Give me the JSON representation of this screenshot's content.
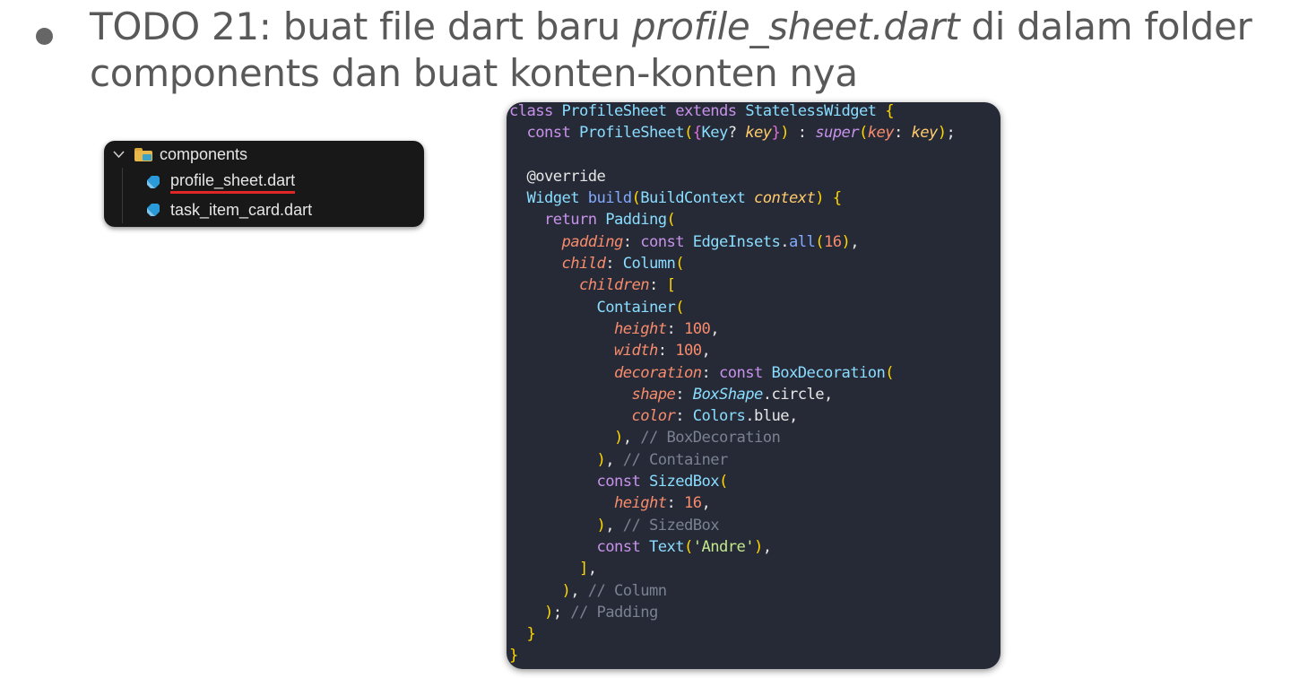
{
  "heading": {
    "part1": "TODO 21: buat file dart baru ",
    "file_italic": "profile_sheet.dart",
    "part2": " di dalam folder components dan buat konten-konten nya"
  },
  "explorer": {
    "folder": "components",
    "files": [
      "profile_sheet.dart",
      "task_item_card.dart"
    ]
  },
  "code_lines": {
    "l1": "class ProfileSheet extends StatelessWidget {",
    "l2": "  const ProfileSheet({Key? key}) : super(key: key);",
    "l3": "",
    "l4": "  @override",
    "l5": "  Widget build(BuildContext context) {",
    "l6": "    return Padding(",
    "l7": "      padding: const EdgeInsets.all(16),",
    "l8": "      child: Column(",
    "l9": "        children: [",
    "l10": "          Container(",
    "l11": "            height: 100,",
    "l12": "            width: 100,",
    "l13": "            decoration: const BoxDecoration(",
    "l14": "              shape: BoxShape.circle,",
    "l15": "              color: Colors.blue,",
    "l16": "            ), // BoxDecoration",
    "l17": "          ), // Container",
    "l18": "          const SizedBox(",
    "l19": "            height: 16,",
    "l20": "          ), // SizedBox",
    "l21": "          const Text('Andre'),",
    "l22": "        ],",
    "l23": "      ), // Column",
    "l24": "    ); // Padding",
    "l25": "  }",
    "l26": "}"
  },
  "colors": {
    "keyword": "#c792ea",
    "type": "#89ddff",
    "param": "#f78c6c",
    "string": "#c3e88d",
    "comment": "#7a8191",
    "code_bg": "#262936",
    "explorer_bg": "#181818",
    "underline": "#e12626"
  }
}
